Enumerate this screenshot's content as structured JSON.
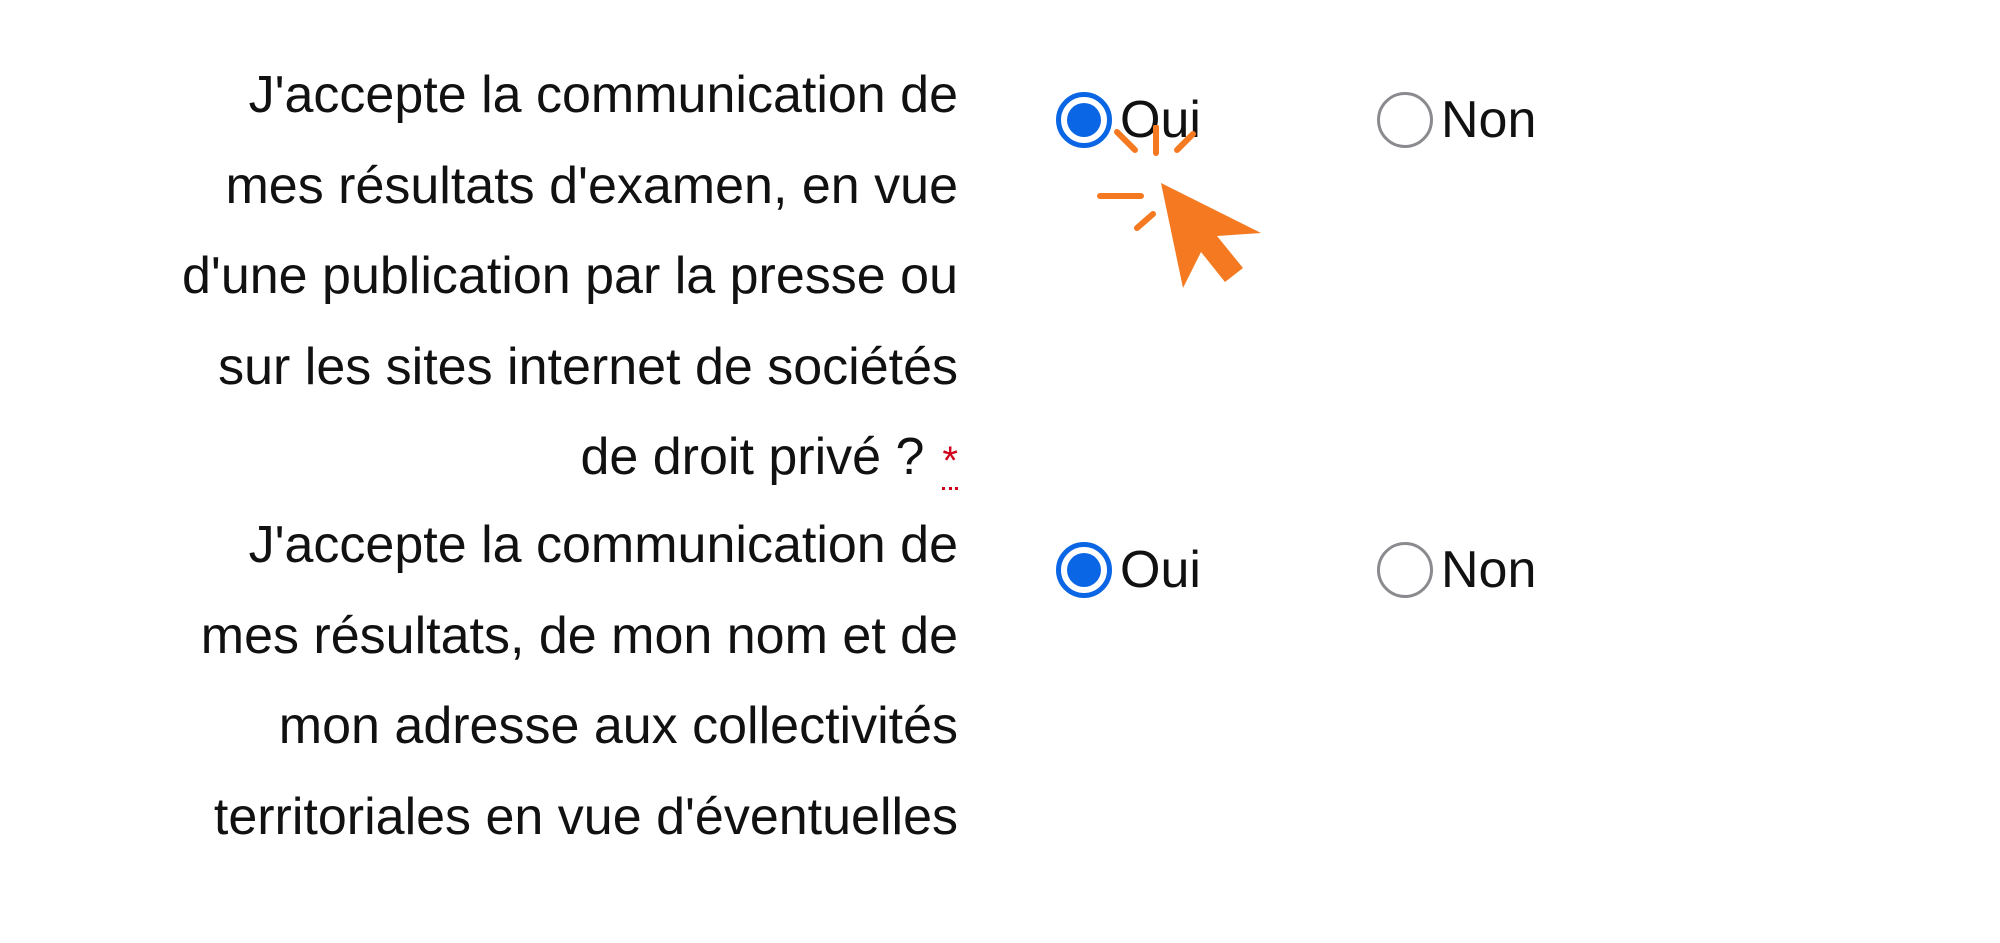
{
  "questions": [
    {
      "lines": [
        "J'accepte la communication de",
        "mes résultats d'examen, en vue",
        "d'une publication par la presse ou",
        "sur les sites internet de sociétés",
        "de droit privé ?"
      ],
      "required_marker": "*",
      "options": [
        {
          "label": "Oui",
          "checked": true
        },
        {
          "label": "Non",
          "checked": false
        }
      ]
    },
    {
      "lines": [
        "J'accepte la communication de",
        "mes résultats, de mon nom et de",
        "mon adresse aux collectivités",
        "territoriales en vue d'éventuelles"
      ],
      "options": [
        {
          "label": "Oui",
          "checked": true
        },
        {
          "label": "Non",
          "checked": false
        }
      ]
    }
  ],
  "colors": {
    "radio_selected": "#0a66e4",
    "radio_unselected_border": "#8a8a8f",
    "required": "#d0021b",
    "cursor": "#f47920"
  },
  "cursor": {
    "icon": "click-cursor-icon",
    "target": "questions.0.options.0"
  }
}
